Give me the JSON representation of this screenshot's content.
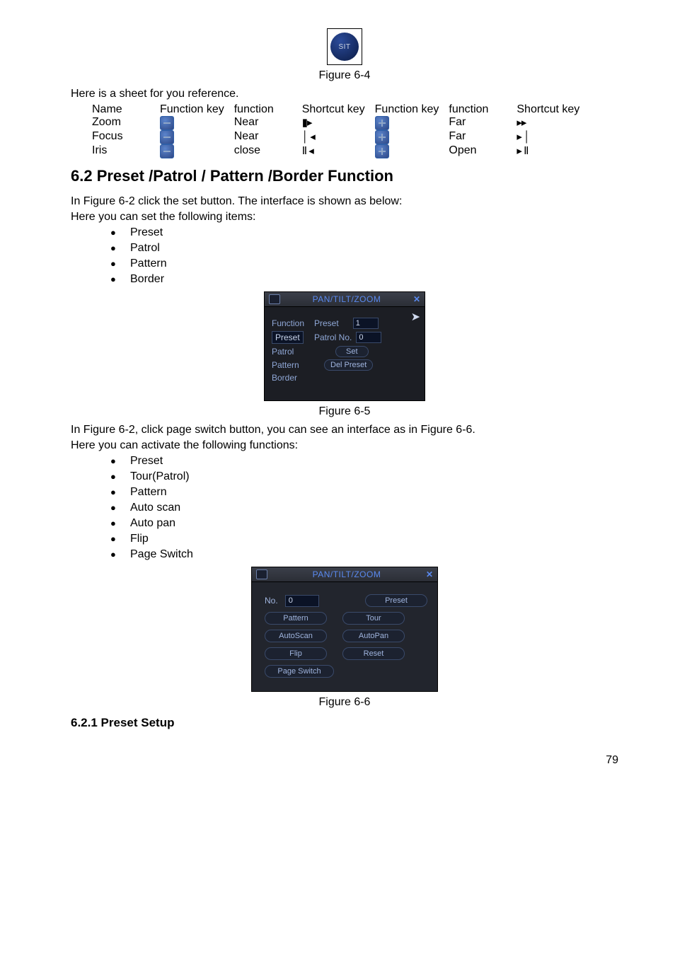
{
  "figure64": {
    "label": "SIT",
    "caption": "Figure 6-4"
  },
  "intro_table": "Here is a sheet for you reference.",
  "table": {
    "head": [
      "Name",
      "Function key",
      "function",
      "Shortcut key",
      "Function key",
      "function",
      "Shortcut key"
    ],
    "rows": [
      {
        "name": "Zoom",
        "f1": "Near",
        "sc1": "▮▸",
        "f2": "Far",
        "sc2": "▸▸"
      },
      {
        "name": "Focus",
        "f1": "Near",
        "sc1": "│ ◂",
        "f2": "Far",
        "sc2": "▸ │"
      },
      {
        "name": "Iris",
        "f1": "close",
        "sc1": "Ⅱ ◂",
        "f2": "Open",
        "sc2": "▸ Ⅱ"
      }
    ]
  },
  "section62": {
    "heading": "6.2  Preset  /Patrol / Pattern /Border  Function",
    "p1": "In Figure 6-2 click the set button. The interface is shown as below:",
    "p2": "Here you can set the following items:",
    "list1": [
      "Preset",
      "Patrol",
      "Pattern",
      "Border"
    ]
  },
  "dialog1": {
    "title": "PAN/TILT/ZOOM",
    "close": "✕",
    "col": {
      "function": "Function",
      "preset": "Preset",
      "patrol": "Patrol",
      "pattern": "Pattern",
      "border": "Border"
    },
    "labels": {
      "preset": "Preset",
      "patrolno": "Patrol No."
    },
    "inputs": {
      "preset": "1",
      "patrolno": "0"
    },
    "btns": {
      "set": "Set",
      "del": "Del Preset"
    }
  },
  "figure65": {
    "caption": "Figure 6-5"
  },
  "para3": "In Figure 6-2, click page switch button, you can see an interface as in Figure 6-6.",
  "para4": "Here you can activate the following functions:",
  "list2": [
    "Preset",
    "Tour(Patrol)",
    "Pattern",
    "Auto scan",
    "Auto pan",
    "Flip",
    "Page Switch"
  ],
  "dialog2": {
    "title": "PAN/TILT/ZOOM",
    "close": "✕",
    "no_label": "No.",
    "no_value": "0",
    "btns": {
      "preset": "Preset",
      "pattern": "Pattern",
      "tour": "Tour",
      "autoscan": "AutoScan",
      "autopan": "AutoPan",
      "flip": "Flip",
      "reset": "Reset",
      "pageswitch": "Page Switch"
    }
  },
  "figure66": {
    "caption": "Figure 6-6"
  },
  "subhead": "6.2.1  Preset Setup",
  "page_number": "79"
}
